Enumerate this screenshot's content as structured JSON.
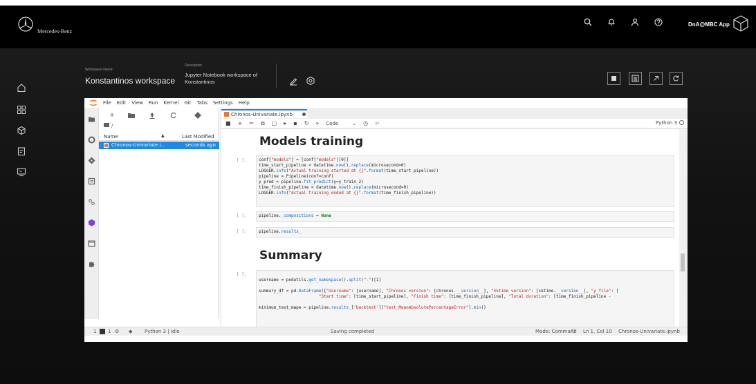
{
  "header": {
    "brand_name": "Mercedes-Benz",
    "app_label": "DnA@MBC App"
  },
  "workspace": {
    "name_label": "Workspace Name",
    "name": "Konstantinos workspace",
    "desc_label": "Description",
    "description": "Jupyter Notebook workspace of Konstantinos"
  },
  "jupyter": {
    "menu": [
      "File",
      "Edit",
      "View",
      "Run",
      "Kernel",
      "Git",
      "Tabs",
      "Settings",
      "Help"
    ],
    "file_browser": {
      "path": "/",
      "col_name": "Name",
      "col_modified": "Last Modified",
      "file_name": "Chronos-Univariate.i...",
      "file_modified": "seconds ago"
    },
    "notebook": {
      "tab_title": "Chronos-Univariate.ipynb",
      "cell_type": "Code",
      "git_label": "git",
      "kernel": "Python 3",
      "heading1": "Models training",
      "heading2": "Summary",
      "prompt": "[ ]:"
    },
    "status": {
      "num1": "1",
      "num2": "1",
      "kernel_state": "Python 3 | Idle",
      "save": "Saving completed",
      "mode": "Mode: Command",
      "cursor": "Ln 1, Col 10",
      "file": "Chronos-Univariate.ipynb"
    }
  },
  "colors": {
    "accent": "#1e88e5",
    "background": "#000000"
  }
}
